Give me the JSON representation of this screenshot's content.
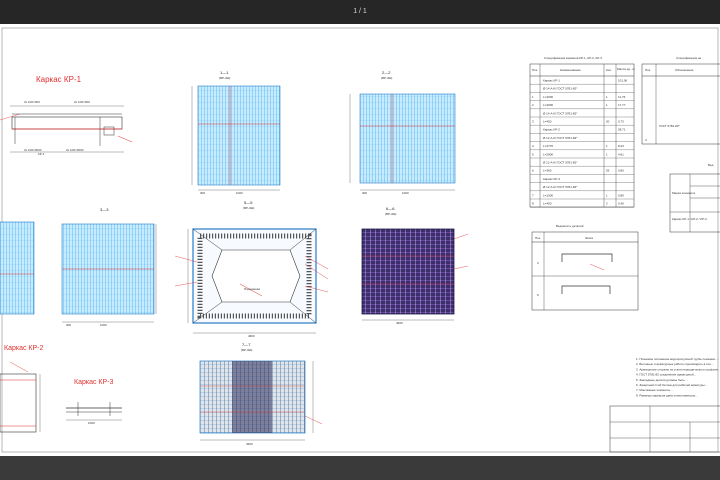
{
  "viewer": {
    "page_indicator": "1 / 1"
  },
  "drawing": {
    "frame_titles": {
      "kr1": "Каркас  КР-1",
      "kr2": "Каркас  КР-2",
      "kr3": "Каркас  КР-3"
    },
    "section_labels": {
      "s1": "1—1",
      "s2": "2—2",
      "s3": "3—3",
      "s4": "4—4",
      "s5": "5—5",
      "s6": "6—6",
      "s7": "7—7"
    },
    "spec_table": {
      "title": "Спецификация каркасов КР-1, КР-2, КР-3",
      "headers": [
        "Поз.",
        "Наименование",
        "Кол.",
        "Масса ед., кг"
      ],
      "rows": [
        [
          "",
          "Каркас КР-1",
          "",
          "101,06"
        ],
        [
          "",
          "Ø 14 А-III ГОСТ 5781-82*",
          "",
          ""
        ],
        [
          "1",
          "L=4600",
          "1",
          "11,76"
        ],
        [
          "2",
          "L=4600",
          "1",
          "17,77"
        ],
        [
          "",
          "Ø 14 А-III ГОСТ 5781-82*",
          "",
          ""
        ],
        [
          "3",
          "L=450",
          "20",
          "0,73"
        ],
        [
          "",
          "Каркас КР-2",
          "",
          "28,71"
        ],
        [
          "",
          "Ø 12 А-III ГОСТ 5781-82*",
          "",
          ""
        ],
        [
          "4",
          "L=4770",
          "1",
          "8,23"
        ],
        [
          "5",
          "L=2800",
          "1",
          "4,61"
        ],
        [
          "",
          "Ø 12 А-III ГОСТ 5781-82*",
          "",
          ""
        ],
        [
          "6",
          "L=360",
          "26",
          "0,80"
        ],
        [
          "",
          "Каркас КР-3",
          "",
          ""
        ],
        [
          "",
          "Ø 12 А-III ГОСТ 5781-82*",
          "",
          ""
        ],
        [
          "7",
          "L=1000",
          "1",
          "0,89"
        ],
        [
          "8",
          "L=450",
          "2",
          "0,40"
        ]
      ]
    },
    "spec_table_right": {
      "title": "Спецификация не",
      "headers": [
        "Поз.",
        "Обозначение"
      ],
      "rows": [
        [
          "",
          ""
        ],
        [
          "",
          ""
        ],
        [
          "",
          ""
        ],
        [
          "",
          "ГОСТ 5781-82*"
        ],
        [
          "4",
          ""
        ]
      ]
    },
    "parts_table": {
      "title": "Ведомость деталей",
      "headers": [
        "Поз.",
        "Эскиз"
      ],
      "rows": [
        [
          "3",
          ""
        ],
        [
          "6",
          ""
        ]
      ]
    },
    "material_table": {
      "title": "Вед",
      "col1": "Марка элемента",
      "row_label": "Каркас КР-1 / КР-2 / КР-3"
    },
    "notes": [
      "1. Плановое положение водопропускной трубы показано ...",
      "2. Бетонные и арматурные работы производить в соо...",
      "3. Арматурные стержни из стали периодического профиля ...",
      "4. ГОСТ 5781-82 соединение арматурной...",
      "5. Закладные детали должны быть ...",
      "6. Защитный слой бетона для рабочей арматуры...",
      "7. Монтажные элементы ...",
      "8. Размеры каркасов даны в миллиметрах..."
    ]
  }
}
